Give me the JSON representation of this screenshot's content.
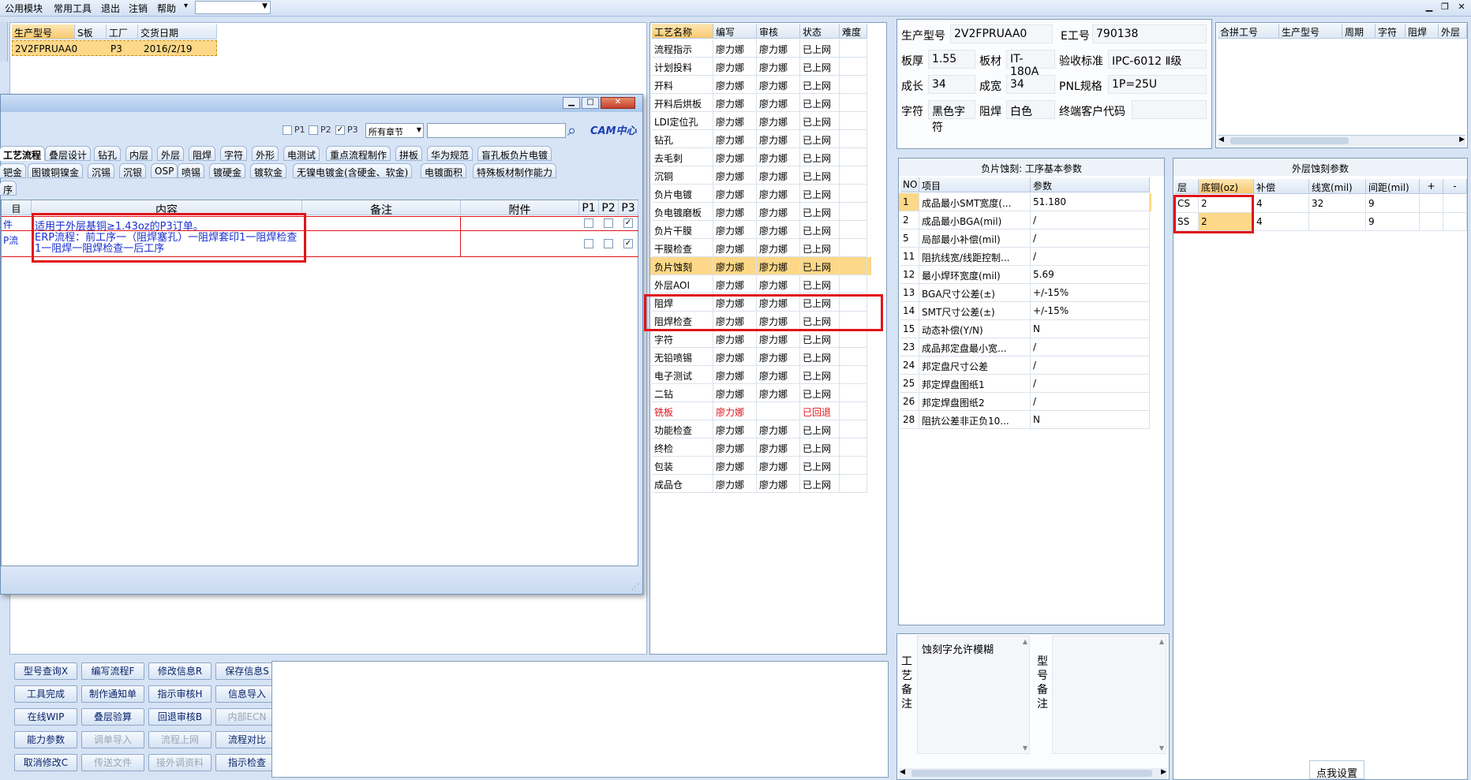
{
  "menu": {
    "items": [
      "公用模块",
      "常用工具",
      "退出",
      "注销",
      "帮助"
    ],
    "extra_arrow": "▾",
    "combo_value": ""
  },
  "product_list": {
    "headers": [
      "生产型号",
      "S板",
      "工厂",
      "交货日期"
    ],
    "rows": [
      [
        "2V2FPRUAA0",
        "",
        "P3",
        "2016/2/19"
      ]
    ]
  },
  "dialog": {
    "filter": {
      "p1": "P1",
      "p2": "P2",
      "p3": "P3",
      "chapter": "所有章节",
      "search_value": ""
    },
    "cam_logo": "CAM中心",
    "tabs_row1": [
      "工艺流程",
      "叠层设计",
      "钻孔",
      "内层",
      "外层",
      "阻焊",
      "字符",
      "外形",
      "电测试",
      "重点流程制作",
      "拼板",
      "华为规范",
      "盲孔板负片电镀"
    ],
    "tabs_row2": [
      "钯金",
      "图镀铜镍金",
      "沉锡",
      "沉银",
      "OSP",
      "喷锡",
      "镀硬金",
      "镀软金",
      "无镍电镀金(含硬金、软金)",
      "电镀面积",
      "特殊板材制作能力"
    ],
    "row3_stub": "序",
    "table_headers": [
      "目",
      "内容",
      "备注",
      "附件",
      "P1",
      "P2",
      "P3"
    ],
    "rows": [
      {
        "col0": "件",
        "content": "适用于外层基铜≥1.43oz的P3订单。",
        "remark": "",
        "attach": ""
      },
      {
        "col0": "P流",
        "content": "ERP流程：前工序一（阻焊塞孔）一阻焊套印1一阻焊检查1一阻焊一阻焊检查一后工序",
        "remark": "",
        "attach": ""
      }
    ]
  },
  "process": {
    "headers": [
      "工艺名称",
      "编写",
      "审核",
      "状态",
      "难度"
    ],
    "rows": [
      [
        "流程指示",
        "廖力娜",
        "廖力娜",
        "已上网",
        ""
      ],
      [
        "计划投料",
        "廖力娜",
        "廖力娜",
        "已上网",
        ""
      ],
      [
        "开料",
        "廖力娜",
        "廖力娜",
        "已上网",
        ""
      ],
      [
        "开料后烘板",
        "廖力娜",
        "廖力娜",
        "已上网",
        ""
      ],
      [
        "LDI定位孔",
        "廖力娜",
        "廖力娜",
        "已上网",
        ""
      ],
      [
        "钻孔",
        "廖力娜",
        "廖力娜",
        "已上网",
        ""
      ],
      [
        "去毛刺",
        "廖力娜",
        "廖力娜",
        "已上网",
        ""
      ],
      [
        "沉铜",
        "廖力娜",
        "廖力娜",
        "已上网",
        ""
      ],
      [
        "负片电镀",
        "廖力娜",
        "廖力娜",
        "已上网",
        ""
      ],
      [
        "负电镀磨板",
        "廖力娜",
        "廖力娜",
        "已上网",
        ""
      ],
      [
        "负片干膜",
        "廖力娜",
        "廖力娜",
        "已上网",
        ""
      ],
      [
        "干膜检查",
        "廖力娜",
        "廖力娜",
        "已上网",
        ""
      ],
      [
        "负片蚀刻",
        "廖力娜",
        "廖力娜",
        "已上网",
        ""
      ],
      [
        "外层AOI",
        "廖力娜",
        "廖力娜",
        "已上网",
        ""
      ],
      [
        "阻焊",
        "廖力娜",
        "廖力娜",
        "已上网",
        ""
      ],
      [
        "阻焊检查",
        "廖力娜",
        "廖力娜",
        "已上网",
        ""
      ],
      [
        "字符",
        "廖力娜",
        "廖力娜",
        "已上网",
        ""
      ],
      [
        "无铅喷锡",
        "廖力娜",
        "廖力娜",
        "已上网",
        ""
      ],
      [
        "电子测试",
        "廖力娜",
        "廖力娜",
        "已上网",
        ""
      ],
      [
        "二钻",
        "廖力娜",
        "廖力娜",
        "已上网",
        ""
      ],
      [
        "铣板",
        "廖力娜",
        "",
        "已回退",
        ""
      ],
      [
        "功能检查",
        "廖力娜",
        "廖力娜",
        "已上网",
        ""
      ],
      [
        "终检",
        "廖力娜",
        "廖力娜",
        "已上网",
        ""
      ],
      [
        "包装",
        "廖力娜",
        "廖力娜",
        "已上网",
        ""
      ],
      [
        "成品仓",
        "廖力娜",
        "廖力娜",
        "已上网",
        ""
      ]
    ],
    "selected_index": 12,
    "returned_index": 20
  },
  "info": {
    "model_label": "生产型号",
    "model_value": "2V2FPRUAA0",
    "eno_label": "E工号",
    "eno_value": "790138",
    "thickness_label": "板厚",
    "thickness_value": "1.55",
    "material_label": "板材",
    "material_value": "IT-180A",
    "standard_label": "验收标准",
    "standard_value": "IPC-6012 Ⅱ级",
    "length_label": "成长",
    "length_value": "34",
    "width_label": "成宽",
    "width_value": "34",
    "pnl_label": "PNL规格",
    "pnl_value": "1P=25U",
    "char_label": "字符",
    "char_value": "黑色字符",
    "mask_label": "阻焊",
    "mask_value": "白色",
    "customer_label": "终端客户代码",
    "customer_value": ""
  },
  "combine": {
    "headers": [
      "合拼工号",
      "生产型号",
      "周期",
      "字符",
      "阻焊",
      "外层"
    ]
  },
  "etch_params": {
    "title": "负片蚀刻: 工序基本参数",
    "headers": [
      "NO",
      "项目",
      "参数"
    ],
    "rows": [
      [
        "1",
        "成品最小SMT宽度(...",
        "51.180"
      ],
      [
        "2",
        "成品最小BGA(mil)",
        "/"
      ],
      [
        "5",
        "局部最小补偿(mil)",
        "/"
      ],
      [
        "11",
        "阻抗线宽/线距控制...",
        "/"
      ],
      [
        "12",
        "最小焊环宽度(mil)",
        "5.69"
      ],
      [
        "13",
        "BGA尺寸公差(±)",
        "+/-15%"
      ],
      [
        "14",
        "SMT尺寸公差(±)",
        "+/-15%"
      ],
      [
        "15",
        "动态补偿(Y/N)",
        "N"
      ],
      [
        "23",
        "成品邦定盘最小宽...",
        "/"
      ],
      [
        "24",
        "邦定盘尺寸公差",
        "/"
      ],
      [
        "25",
        "邦定焊盘图纸1",
        "/"
      ],
      [
        "26",
        "邦定焊盘图纸2",
        "/"
      ],
      [
        "28",
        "阻抗公差非正负10...",
        "N"
      ]
    ]
  },
  "outer_etch": {
    "title": "外层蚀刻参数",
    "headers": [
      "层",
      "底铜(oz)",
      "补偿",
      "线宽(mil)",
      "间距(mil)",
      "+",
      "-"
    ],
    "rows": [
      [
        "CS",
        "2",
        "4",
        "32",
        "9",
        "",
        ""
      ],
      [
        "SS",
        "2",
        "4",
        "",
        "9",
        "",
        ""
      ]
    ]
  },
  "remarks": {
    "process_label": "工艺备注",
    "process_text": "蚀刻字允许模糊",
    "model_label": "型号备注",
    "model_text": ""
  },
  "set_button": "点我设置",
  "buttons": [
    [
      "型号查询X",
      "编写流程F",
      "修改信息R",
      "保存信息S"
    ],
    [
      "工具完成",
      "制作通知单",
      "指示审核H",
      "信息导入"
    ],
    [
      "在线WIP",
      "叠层验算",
      "回退审核B",
      "内部ECN"
    ],
    [
      "能力参数",
      "调单导入",
      "流程上网",
      "流程对比"
    ],
    [
      "取消修改C",
      "传送文件",
      "接外调资料",
      "指示检查"
    ]
  ],
  "disabled_buttons": [
    "内部ECN",
    "调单导入",
    "流程上网",
    "传送文件",
    "接外调资料"
  ],
  "colors": {
    "selected_row": "#fcd888",
    "returned_text": "#e0141a",
    "highlight_box": "#e0141a",
    "content_text": "#1a2fd0"
  }
}
